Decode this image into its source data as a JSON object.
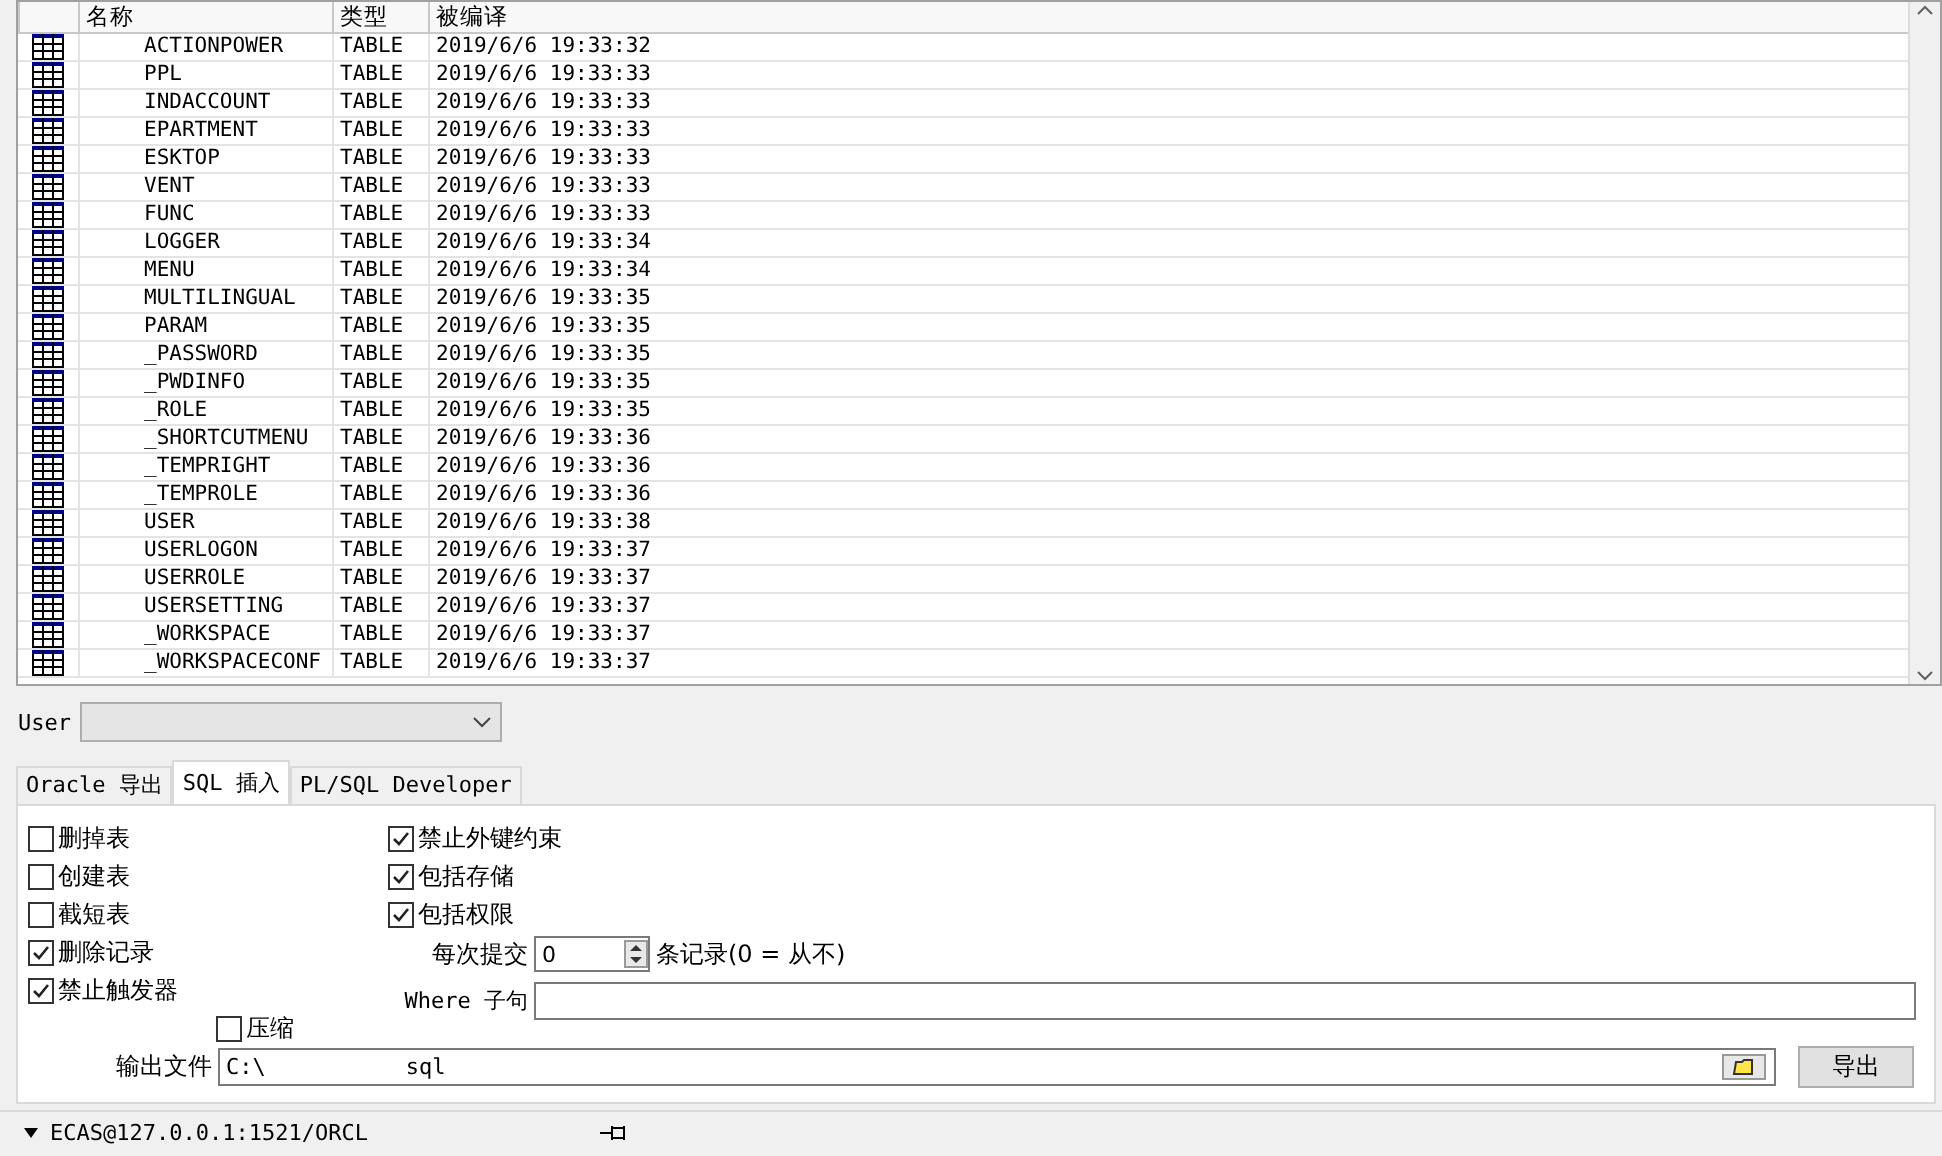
{
  "table": {
    "columns": [
      "名称",
      "类型",
      "被编译"
    ],
    "rows": [
      {
        "name": "ACTIONPOWER",
        "type": "TABLE",
        "compiled": "2019/6/6 19:33:32"
      },
      {
        "name": "PPL",
        "type": "TABLE",
        "compiled": "2019/6/6 19:33:33"
      },
      {
        "name": "INDACCOUNT",
        "type": "TABLE",
        "compiled": "2019/6/6 19:33:33"
      },
      {
        "name": "EPARTMENT",
        "type": "TABLE",
        "compiled": "2019/6/6 19:33:33"
      },
      {
        "name": "ESKTOP",
        "type": "TABLE",
        "compiled": "2019/6/6 19:33:33"
      },
      {
        "name": "VENT",
        "type": "TABLE",
        "compiled": "2019/6/6 19:33:33"
      },
      {
        "name": "FUNC",
        "type": "TABLE",
        "compiled": "2019/6/6 19:33:33"
      },
      {
        "name": "LOGGER",
        "type": "TABLE",
        "compiled": "2019/6/6 19:33:34"
      },
      {
        "name": "MENU",
        "type": "TABLE",
        "compiled": "2019/6/6 19:33:34"
      },
      {
        "name": "MULTILINGUAL",
        "type": "TABLE",
        "compiled": "2019/6/6 19:33:35"
      },
      {
        "name": "PARAM",
        "type": "TABLE",
        "compiled": "2019/6/6 19:33:35"
      },
      {
        "name": "_PASSWORD",
        "type": "TABLE",
        "compiled": "2019/6/6 19:33:35"
      },
      {
        "name": "_PWDINFO",
        "type": "TABLE",
        "compiled": "2019/6/6 19:33:35"
      },
      {
        "name": "_ROLE",
        "type": "TABLE",
        "compiled": "2019/6/6 19:33:35"
      },
      {
        "name": "_SHORTCUTMENU",
        "type": "TABLE",
        "compiled": "2019/6/6 19:33:36"
      },
      {
        "name": "_TEMPRIGHT",
        "type": "TABLE",
        "compiled": "2019/6/6 19:33:36"
      },
      {
        "name": "_TEMPROLE",
        "type": "TABLE",
        "compiled": "2019/6/6 19:33:36"
      },
      {
        "name": "USER",
        "type": "TABLE",
        "compiled": "2019/6/6 19:33:38"
      },
      {
        "name": "USERLOGON",
        "type": "TABLE",
        "compiled": "2019/6/6 19:33:37"
      },
      {
        "name": "USERROLE",
        "type": "TABLE",
        "compiled": "2019/6/6 19:33:37"
      },
      {
        "name": "USERSETTING",
        "type": "TABLE",
        "compiled": "2019/6/6 19:33:37"
      },
      {
        "name": "_WORKSPACE",
        "type": "TABLE",
        "compiled": "2019/6/6 19:33:37"
      },
      {
        "name": "_WORKSPACECONF",
        "type": "TABLE",
        "compiled": "2019/6/6 19:33:37"
      }
    ]
  },
  "user": {
    "label": "User"
  },
  "tabs": [
    {
      "label": "Oracle 导出",
      "selected": false
    },
    {
      "label": "SQL 插入",
      "selected": true
    },
    {
      "label": "PL/SQL Developer",
      "selected": false
    }
  ],
  "options_left": [
    {
      "label": "删掉表",
      "checked": false
    },
    {
      "label": "创建表",
      "checked": false
    },
    {
      "label": "截短表",
      "checked": false
    },
    {
      "label": "删除记录",
      "checked": true
    },
    {
      "label": "禁止触发器",
      "checked": true
    }
  ],
  "options_right": [
    {
      "label": "禁止外键约束",
      "checked": true
    },
    {
      "label": "包括存储",
      "checked": true
    },
    {
      "label": "包括权限",
      "checked": true
    }
  ],
  "commit": {
    "label": "每次提交",
    "value": "0",
    "suffix": "条记录(0 = 从不)"
  },
  "where": {
    "label": "Where 子句"
  },
  "compress": {
    "label": "压缩",
    "checked": false
  },
  "output": {
    "label": "输出文件",
    "value_start": "C:\\",
    "value_end": "sql"
  },
  "export_button": "导出",
  "status_bar": {
    "connection": "ECAS@127.0.0.1:1521/ORCL"
  }
}
